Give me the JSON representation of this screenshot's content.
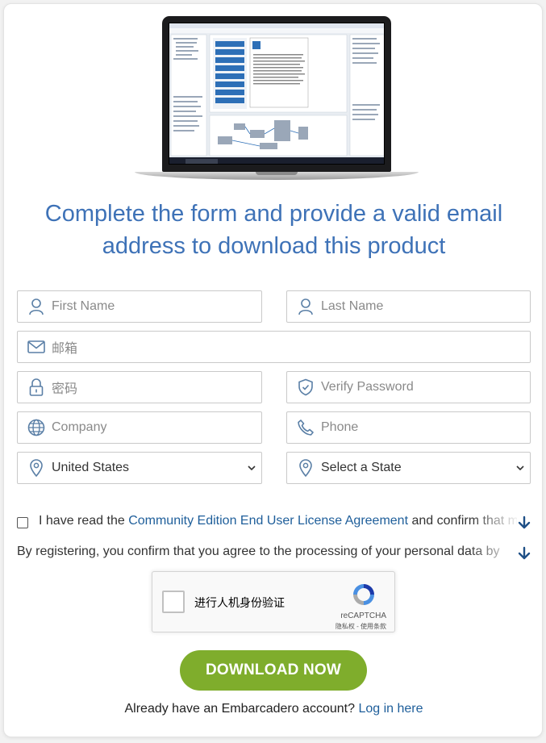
{
  "heading": {
    "line1": "Complete the form and provide a valid email",
    "line2": "address to download this product"
  },
  "form": {
    "first_name_placeholder": "First Name",
    "last_name_placeholder": "Last Name",
    "email_placeholder": "邮箱",
    "password_placeholder": "密码",
    "verify_password_placeholder": "Verify Password",
    "company_placeholder": "Company",
    "phone_placeholder": "Phone",
    "country_value": "United States",
    "state_value": "Select a State"
  },
  "agreement": {
    "prefix": "I have read the ",
    "link": "Community Edition End User License Agreement",
    "suffix": " and confirm that my"
  },
  "consent": {
    "text": "By registering, you confirm that you agree to the processing of your personal data by"
  },
  "recaptcha": {
    "label": "进行人机身份验证",
    "brand": "reCAPTCHA",
    "links": "隐私权 - 使用条款"
  },
  "download_label": "DOWNLOAD NOW",
  "login": {
    "prompt": "Already have an Embarcadero account? ",
    "link": "Log in here"
  },
  "icons": {
    "first_name": "user-icon",
    "last_name": "user-icon",
    "email": "envelope-icon",
    "password": "lock-icon",
    "verify_password": "shield-check-icon",
    "company": "globe-icon",
    "phone": "phone-icon",
    "country": "map-pin-icon",
    "state": "map-pin-icon",
    "expand": "arrow-down-icon"
  },
  "colors": {
    "heading": "#3e72b7",
    "link": "#1e5e9a",
    "download_button": "#7fad2c",
    "icon": "#5a7fa6"
  }
}
